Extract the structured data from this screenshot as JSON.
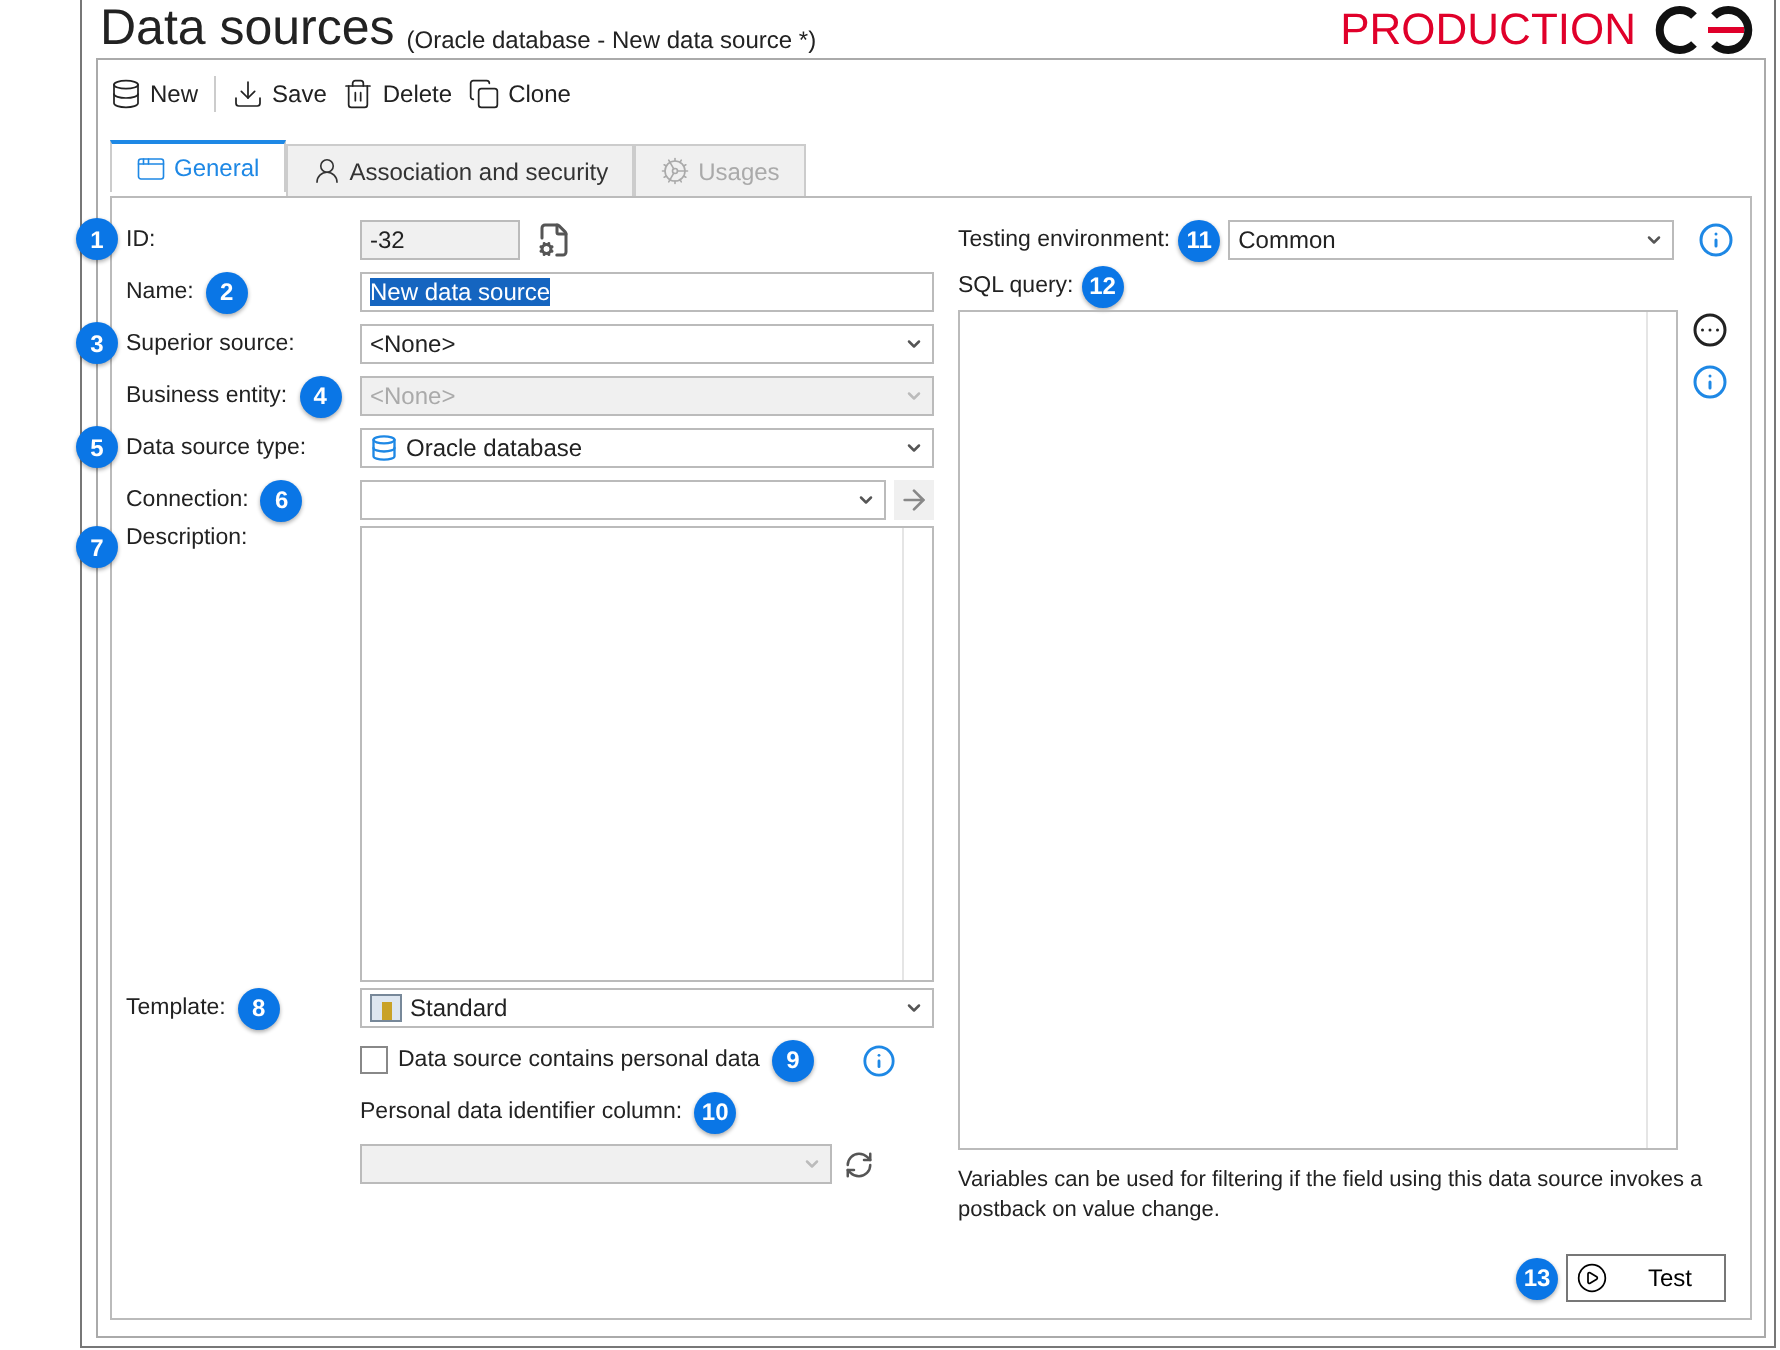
{
  "window": {
    "title": "Data sources",
    "subtitle": "(Oracle database - New data source *)",
    "environment": "PRODUCTION"
  },
  "toolbar": [
    {
      "label": "New",
      "kind": "new"
    },
    {
      "label": "Save",
      "kind": "save"
    },
    {
      "label": "Delete",
      "kind": "delete"
    },
    {
      "label": "Clone",
      "kind": "clone"
    }
  ],
  "tabs": [
    {
      "label": "General",
      "kind": "general",
      "selected": true,
      "disabled": false
    },
    {
      "label": "Association and security",
      "kind": "security",
      "selected": false,
      "disabled": false
    },
    {
      "label": "Usages",
      "kind": "usages",
      "selected": false,
      "disabled": true
    }
  ],
  "left_fields": [
    {
      "kind": "readonly",
      "label": "ID:",
      "value": "-32",
      "badge": {
        "number": "1",
        "kind": "margin"
      }
    },
    {
      "kind": "text",
      "label": "Name:",
      "value": "New data source",
      "badge": {
        "number": "2",
        "kind": "inline"
      },
      "highlighted": true
    },
    {
      "kind": "dropdown",
      "label": "Superior source:",
      "value": "<None>",
      "badge": {
        "number": "3",
        "kind": "margin"
      },
      "disabled": false
    },
    {
      "kind": "dropdown",
      "label": "Business entity:",
      "value": "<None>",
      "badge": {
        "number": "4",
        "kind": "inline"
      },
      "disabled": true
    },
    {
      "kind": "database_dropdown",
      "label": "Data source type:",
      "value": "Oracle database",
      "badge": {
        "number": "5",
        "kind": "margin"
      },
      "disabled": false
    },
    {
      "kind": "dropdown",
      "label": "Connection:",
      "badge": {
        "number": "6",
        "kind": "inline"
      },
      "disabled": false,
      "arrow": true
    },
    {
      "kind": "textarea",
      "label": "Description:",
      "badge": {
        "number": "7",
        "kind": "margin"
      }
    },
    {
      "kind": "template_dropdown",
      "label": "Template:",
      "value": "Standard",
      "badge": {
        "number": "8",
        "kind": "inline"
      },
      "disabled": false
    }
  ],
  "personal_data": {
    "checkbox_label": "Data source contains personal data",
    "checked": false,
    "badge": "9",
    "column_label": "Personal data identifier column:",
    "column_badge": "10",
    "column_disabled": true
  },
  "right": {
    "environment_label": "Testing environment:",
    "environment_badge": "11",
    "environment_value": "Common",
    "query_label": "SQL query:",
    "query_badge": "12",
    "hint": "Variables can be used for filtering if the field using this data source invokes a postback on value change.",
    "test_button": "Test",
    "test_badge": "13"
  }
}
